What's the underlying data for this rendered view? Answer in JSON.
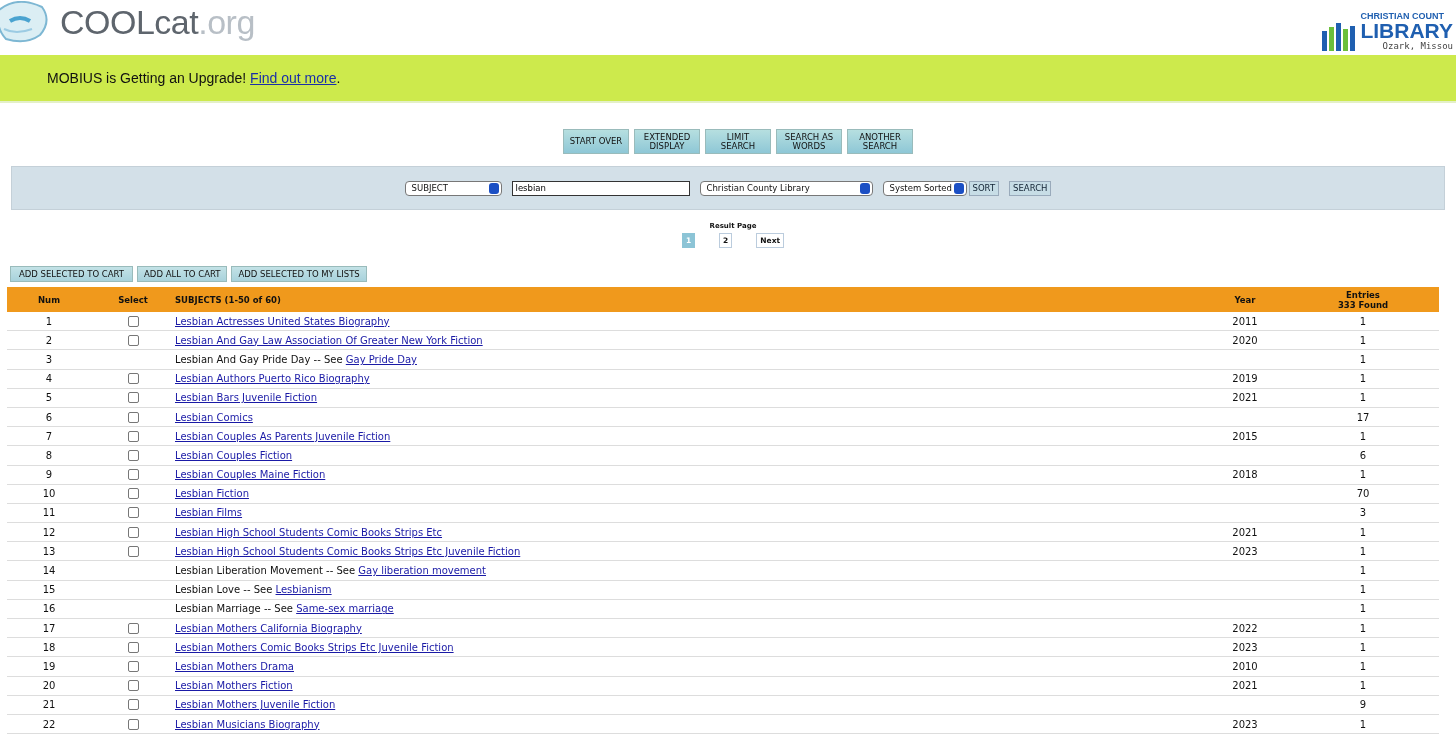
{
  "header": {
    "logo_main": "COOLcat",
    "logo_suffix": ".org",
    "partner_logo": {
      "line1": "CHRISTIAN COUNT",
      "line2": "LIBRARY",
      "line3": "Ozark, Missou"
    }
  },
  "banner": {
    "text": "MOBIUS is Getting an Upgrade! ",
    "link": "Find out more",
    "after": "."
  },
  "nav_buttons": [
    [
      "START OVER"
    ],
    [
      "EXTENDED",
      "DISPLAY"
    ],
    [
      "LIMIT",
      "SEARCH"
    ],
    [
      "SEARCH AS",
      "WORDS"
    ],
    [
      "ANOTHER",
      "SEARCH"
    ]
  ],
  "search": {
    "index": "SUBJECT",
    "query": "lesbian",
    "location": "Christian County Library",
    "sort": "System Sorted",
    "sort_button": "SORT",
    "search_button": "SEARCH"
  },
  "pagination": {
    "label": "Result Page",
    "pages": [
      {
        "label": "1",
        "selected": true
      },
      {
        "label": "2",
        "selected": false
      }
    ],
    "next": "Next"
  },
  "actions": [
    "ADD SELECTED TO CART",
    "ADD ALL TO CART",
    "ADD SELECTED TO MY LISTS"
  ],
  "table": {
    "columns": {
      "num": "Num",
      "select": "Select",
      "subjects": "SUBJECTS (1-50 of 60)",
      "year": "Year",
      "entries": [
        "Entries",
        "333 Found"
      ]
    },
    "rows": [
      {
        "kind": "link",
        "num": "1",
        "checked": false,
        "title": "Lesbian Actresses United States Biography",
        "year": "2011",
        "entries": "1"
      },
      {
        "kind": "link",
        "num": "2",
        "checked": false,
        "title": "Lesbian And Gay Law Association Of Greater New York Fiction",
        "year": "2020",
        "entries": "1"
      },
      {
        "kind": "see",
        "num": "3",
        "title": "Lesbian And Gay Pride Day -- See ",
        "see": "Gay Pride Day",
        "entries": "1"
      },
      {
        "kind": "link",
        "num": "4",
        "checked": false,
        "title": "Lesbian Authors Puerto Rico Biography",
        "year": "2019",
        "entries": "1"
      },
      {
        "kind": "link",
        "num": "5",
        "checked": false,
        "title": "Lesbian Bars Juvenile Fiction",
        "year": "2021",
        "entries": "1"
      },
      {
        "kind": "link",
        "num": "6",
        "checked": false,
        "title": "Lesbian Comics",
        "entries": "17"
      },
      {
        "kind": "link",
        "num": "7",
        "checked": false,
        "title": "Lesbian Couples As Parents Juvenile Fiction",
        "year": "2015",
        "entries": "1"
      },
      {
        "kind": "link",
        "num": "8",
        "checked": false,
        "title": "Lesbian Couples Fiction",
        "entries": "6"
      },
      {
        "kind": "link",
        "num": "9",
        "checked": false,
        "title": "Lesbian Couples Maine Fiction",
        "year": "2018",
        "entries": "1"
      },
      {
        "kind": "link",
        "num": "10",
        "checked": false,
        "title": "Lesbian Fiction",
        "entries": "70"
      },
      {
        "kind": "link",
        "num": "11",
        "checked": false,
        "title": "Lesbian Films",
        "entries": "3"
      },
      {
        "kind": "link",
        "num": "12",
        "checked": false,
        "title": "Lesbian High School Students Comic Books Strips Etc",
        "year": "2021",
        "entries": "1"
      },
      {
        "kind": "link",
        "num": "13",
        "checked": false,
        "title": "Lesbian High School Students Comic Books Strips Etc Juvenile Fiction",
        "year": "2023",
        "entries": "1"
      },
      {
        "kind": "see",
        "num": "14",
        "title": "Lesbian Liberation Movement -- See ",
        "see": "Gay liberation movement",
        "entries": "1"
      },
      {
        "kind": "see",
        "num": "15",
        "title": "Lesbian Love -- See ",
        "see": "Lesbianism",
        "entries": "1"
      },
      {
        "kind": "see",
        "num": "16",
        "title": "Lesbian Marriage -- See ",
        "see": "Same-sex marriage",
        "entries": "1"
      },
      {
        "kind": "link",
        "num": "17",
        "checked": false,
        "title": "Lesbian Mothers California Biography",
        "year": "2022",
        "entries": "1"
      },
      {
        "kind": "link",
        "num": "18",
        "checked": false,
        "title": "Lesbian Mothers Comic Books Strips Etc Juvenile Fiction",
        "year": "2023",
        "entries": "1"
      },
      {
        "kind": "link",
        "num": "19",
        "checked": false,
        "title": "Lesbian Mothers Drama",
        "year": "2010",
        "entries": "1"
      },
      {
        "kind": "link",
        "num": "20",
        "checked": false,
        "title": "Lesbian Mothers Fiction",
        "year": "2021",
        "entries": "1"
      },
      {
        "kind": "link",
        "num": "21",
        "checked": false,
        "title": "Lesbian Mothers Juvenile Fiction",
        "entries": "9"
      },
      {
        "kind": "link",
        "num": "22",
        "checked": false,
        "title": "Lesbian Musicians Biography",
        "year": "2023",
        "entries": "1"
      }
    ]
  }
}
